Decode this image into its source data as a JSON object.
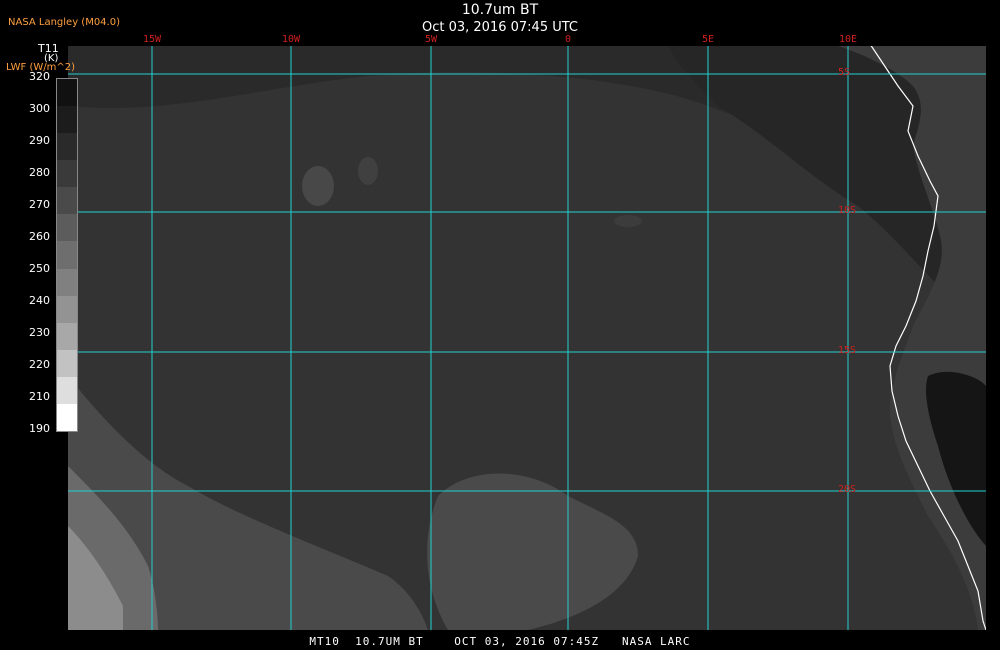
{
  "header": {
    "credit": "NASA Langley (M04.0)",
    "title": "10.7um BT",
    "subtitle": "Oct 03, 2016 07:45 UTC"
  },
  "legend": {
    "variable": "T11",
    "unit": "(K)",
    "secondary": "LWF (W/m^2)",
    "ticks": [
      "320",
      "300",
      "290",
      "280",
      "270",
      "260",
      "250",
      "240",
      "230",
      "220",
      "210",
      "190"
    ],
    "swatch_colors": [
      "#111111",
      "#1c1c1c",
      "#2a2a2a",
      "#3a3a3a",
      "#4a4a4a",
      "#5c5c5c",
      "#6e6e6e",
      "#808080",
      "#939393",
      "#a8a8a8",
      "#c2c2c2",
      "#dedede",
      "#ffffff"
    ]
  },
  "map": {
    "lon_labels": [
      "15W",
      "10W",
      "5W",
      "0",
      "5E",
      "10E"
    ],
    "lat_labels": [
      "5S",
      "10S",
      "15S",
      "20S"
    ],
    "grid_color": "#20d0d0",
    "label_color": "#d02020",
    "coast_color": "#ffffff"
  },
  "footer": {
    "text": "MT10  10.7UM BT    OCT 03, 2016 07:45Z   NASA LARC"
  }
}
